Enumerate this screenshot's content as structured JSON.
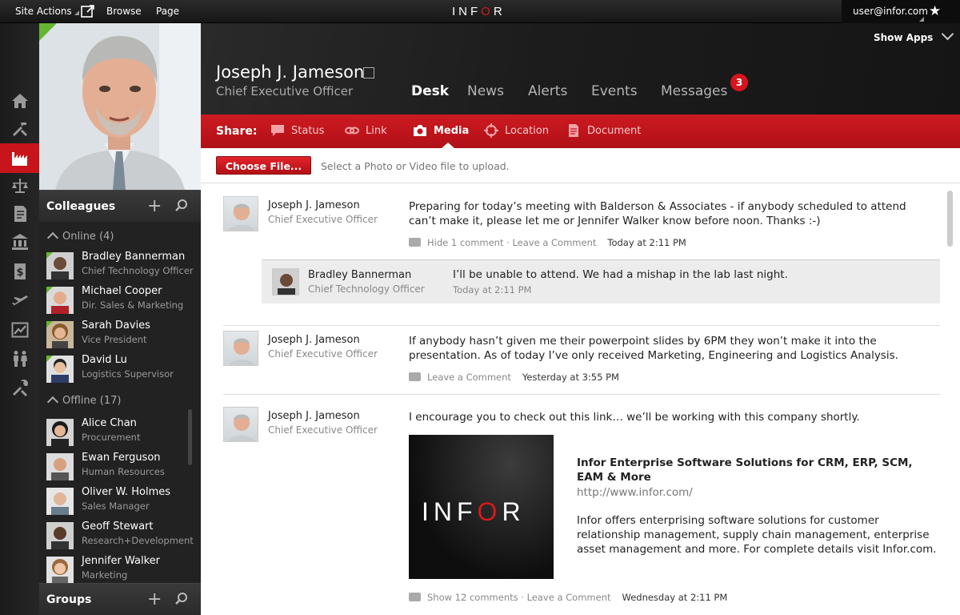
{
  "topbar": {
    "site_actions": "Site Actions",
    "browse": "Browse",
    "page": "Page",
    "logo_left": "INF",
    "logo_accent": "O",
    "logo_right": "R",
    "user": "user@infor.com"
  },
  "profile": {
    "name": "Joseph J. Jameson",
    "title": "Chief Executive Officer",
    "show_apps": "Show Apps"
  },
  "tabs": [
    {
      "label": "Desk"
    },
    {
      "label": "News"
    },
    {
      "label": "Alerts"
    },
    {
      "label": "Events"
    },
    {
      "label": "Messages"
    }
  ],
  "messages_count": "3",
  "share": {
    "label": "Share:",
    "items": [
      {
        "label": "Status"
      },
      {
        "label": "Link"
      },
      {
        "label": "Media"
      },
      {
        "label": "Location"
      },
      {
        "label": "Document"
      }
    ]
  },
  "upload": {
    "button": "Choose File...",
    "hint": "Select a Photo or Video file to upload."
  },
  "sidebar": {
    "colleagues_title": "Colleagues",
    "online_label": "Online (4)",
    "offline_label": "Offline (17)",
    "groups_title": "Groups",
    "online": [
      {
        "name": "Bradley Bannerman",
        "title": "Chief Technology Officer"
      },
      {
        "name": "Michael Cooper",
        "title": "Dir. Sales & Marketing"
      },
      {
        "name": "Sarah Davies",
        "title": "Vice President"
      },
      {
        "name": "David Lu",
        "title": "Logistics Supervisor"
      }
    ],
    "offline": [
      {
        "name": "Alice Chan",
        "title": "Procurement"
      },
      {
        "name": "Ewan Ferguson",
        "title": "Human Resources"
      },
      {
        "name": "Oliver W. Holmes",
        "title": "Sales Manager"
      },
      {
        "name": "Geoff Stewart",
        "title": "Research+Development"
      },
      {
        "name": "Jennifer Walker",
        "title": "Marketing"
      }
    ]
  },
  "feed": [
    {
      "name": "Joseph J. Jameson",
      "title": "Chief Executive Officer",
      "text": "Preparing for today’s meeting with Balderson & Associates - if anybody scheduled to attend can’t make it, please let me or Jennifer Walker know before noon. Thanks :-)",
      "comments": "Hide 1 comment",
      "leave": "Leave a Comment",
      "time": "Today at 2:11 PM",
      "reply": {
        "name": "Bradley Bannerman",
        "title": "Chief Technology Officer",
        "text": "I’ll be unable to attend. We had a mishap in the lab last night.",
        "time": "Today at 2:11 PM"
      }
    },
    {
      "name": "Joseph J. Jameson",
      "title": "Chief Executive Officer",
      "text": "If anybody hasn’t given me their powerpoint slides by 6PM they won’t make it into the presentation. As of today I’ve only received Marketing, Engineering and Logistics Analysis.",
      "leave": "Leave a Comment",
      "time": "Yesterday at 3:55 PM"
    },
    {
      "name": "Joseph J. Jameson",
      "title": "Chief Executive Officer",
      "text": "I encourage you to check out this link… we’ll be working with this company shortly.",
      "comments": "Show 12 comments",
      "leave": "Leave a Comment",
      "time": "Wednesday at 2:11 PM",
      "link": {
        "title": "Infor Enterprise Software Solutions for CRM, ERP, SCM, EAM & More",
        "url": "http://www.infor.com/",
        "desc": "Infor offers enterprising software solutions for customer relationship management, supply chain management, enterprise asset management and more. For complete details visit Infor.com."
      }
    }
  ],
  "icons": {
    "rail": [
      "home-icon",
      "tools-icon",
      "factory-icon",
      "scales-icon",
      "document-icon",
      "bank-icon",
      "dollar-icon",
      "plane-icon",
      "chart-icon",
      "people-icon",
      "wrench-icon"
    ]
  },
  "colors": {
    "accent": "#c8141b",
    "status_online": "#64b52f"
  }
}
